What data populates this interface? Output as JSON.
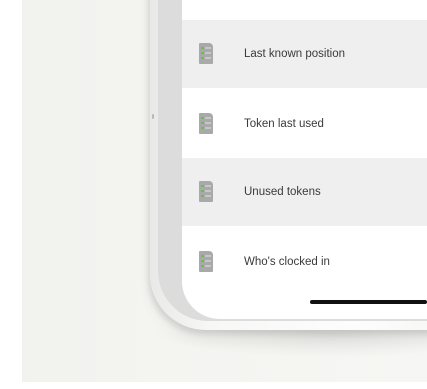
{
  "list": {
    "items": [
      {
        "label": "Last known position",
        "icon": "document-list-icon"
      },
      {
        "label": "Token last used",
        "icon": "document-list-icon"
      },
      {
        "label": "Unused tokens",
        "icon": "document-list-icon"
      },
      {
        "label": "Who's clocked in",
        "icon": "document-list-icon"
      }
    ]
  },
  "colors": {
    "row_alt": "#efefef",
    "icon_body": "#a9a9a9",
    "icon_accent": "#63c34a",
    "text": "#3a3a3a"
  }
}
